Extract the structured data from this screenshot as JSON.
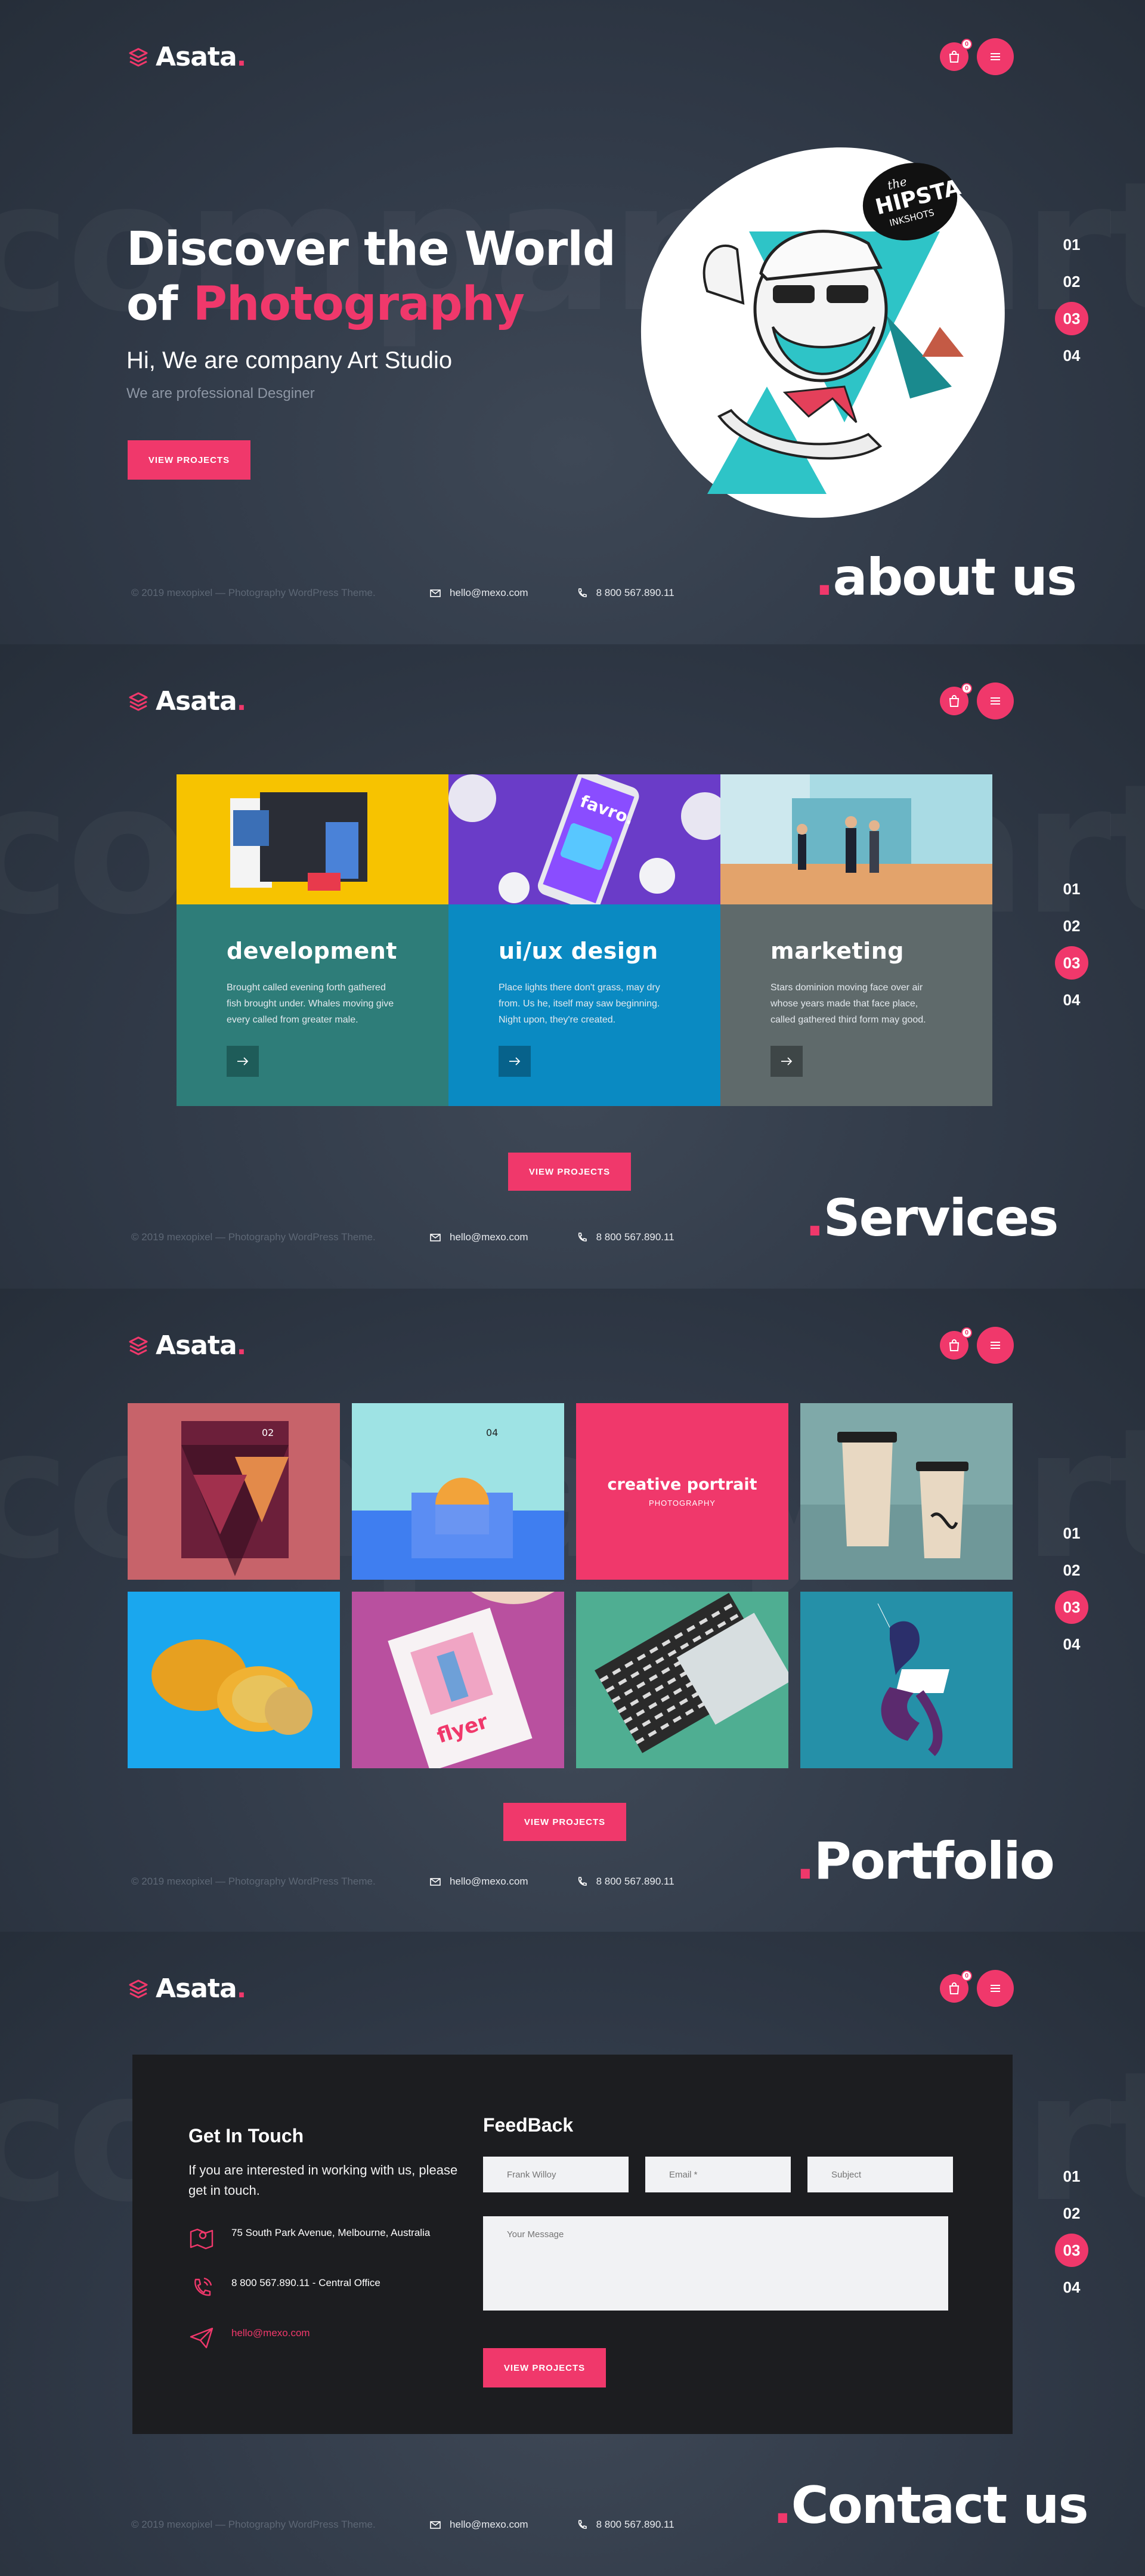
{
  "brand": {
    "name": "Asata",
    "dot": ".",
    "accent": "#f0386b"
  },
  "header": {
    "cart_count": "0"
  },
  "watermark_text": "company art studio",
  "pager": [
    "01",
    "02",
    "03",
    "04"
  ],
  "footer": {
    "copyright": "© 2019 mexopixel — Photography WordPress Theme.",
    "email": "hello@mexo.com",
    "phone": "8 800 567.890.11"
  },
  "hero": {
    "title_line1": "Discover the World",
    "title_line2_prefix": "of ",
    "title_highlight": "Photography",
    "subtitle": "Hi, We are company Art Studio",
    "tagline": "We are professional Desginer",
    "button": "VIEW PROJECTS",
    "badge_top": "the",
    "badge_main": "HIPSTA",
    "badge_bottom": "INKSHOTS",
    "section_title": "about us"
  },
  "services": {
    "items": [
      {
        "title": "development",
        "text": "Brought called evening forth gathered fish brought under. Whales moving give every called from greater male.",
        "color": "#2e7d79"
      },
      {
        "title": "ui/ux design",
        "text": "Place lights there don't grass, may dry from. Us he, itself may saw beginning. Night upon, they're created.",
        "color": "#0a8ac2"
      },
      {
        "title": "marketing",
        "text": "Stars dominion moving face over air whose years made that face place, called gathered third form may good.",
        "color": "#5f6a6b"
      }
    ],
    "phone_app_name": "favro.",
    "button": "VIEW PROJECTS",
    "section_title": "Services"
  },
  "portfolio": {
    "tile1_number": "02",
    "tile2_number": "04",
    "feature_title": "creative portrait",
    "feature_sub": "PHOTOGRAPHY",
    "flyer_text": "flyer",
    "button": "VIEW PROJECTS",
    "section_title": "Portfolio"
  },
  "contact": {
    "heading": "Get In Touch",
    "intro": "If you are interested in working with us, please get in touch.",
    "address": "75 South Park Avenue, Melbourne, Australia",
    "phone": "8 800 567.890.11 - Central Office",
    "email": "hello@mexo.com",
    "form_heading": "FeedBack",
    "name_placeholder": "Frank Willoy",
    "email_placeholder": "Email *",
    "subject_placeholder": "Subject",
    "message_placeholder": "Your Message",
    "button": "VIEW PROJECTS",
    "section_title": "Contact us"
  }
}
